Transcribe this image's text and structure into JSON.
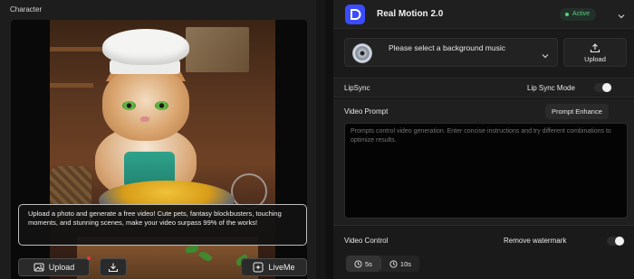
{
  "character": {
    "title": "Character",
    "tip": "Upload a photo and generate a free video! Cute pets, fantasy blockbusters, touching moments, and stunning scenes, make your video surpass 99% of the works!",
    "upload_label": "Upload",
    "liveme_label": "LiveMe"
  },
  "model": {
    "name": "Real Motion 2.0",
    "status": "Active",
    "status_color": "#58d07a",
    "logo_color": "#3b4bff"
  },
  "music": {
    "placeholder": "Please select a background music",
    "upload_label": "Upload"
  },
  "lipsync": {
    "label": "LipSync",
    "mode_label": "Lip Sync Mode"
  },
  "prompt": {
    "label": "Video Prompt",
    "enhance_label": "Prompt Enhance",
    "placeholder": "Prompts control video generation. Enter concise instructions and try different combinations to optimize results."
  },
  "video_control": {
    "label": "Video Control",
    "watermark_label": "Remove watermark",
    "durations": [
      {
        "label": "5s",
        "selected": true
      },
      {
        "label": "10s",
        "selected": false
      }
    ]
  },
  "icons": {
    "upload": "image-icon",
    "download": "download-icon",
    "liveme": "liveme-icon",
    "clock": "clock-icon",
    "chevron": "chevron-down-icon"
  }
}
